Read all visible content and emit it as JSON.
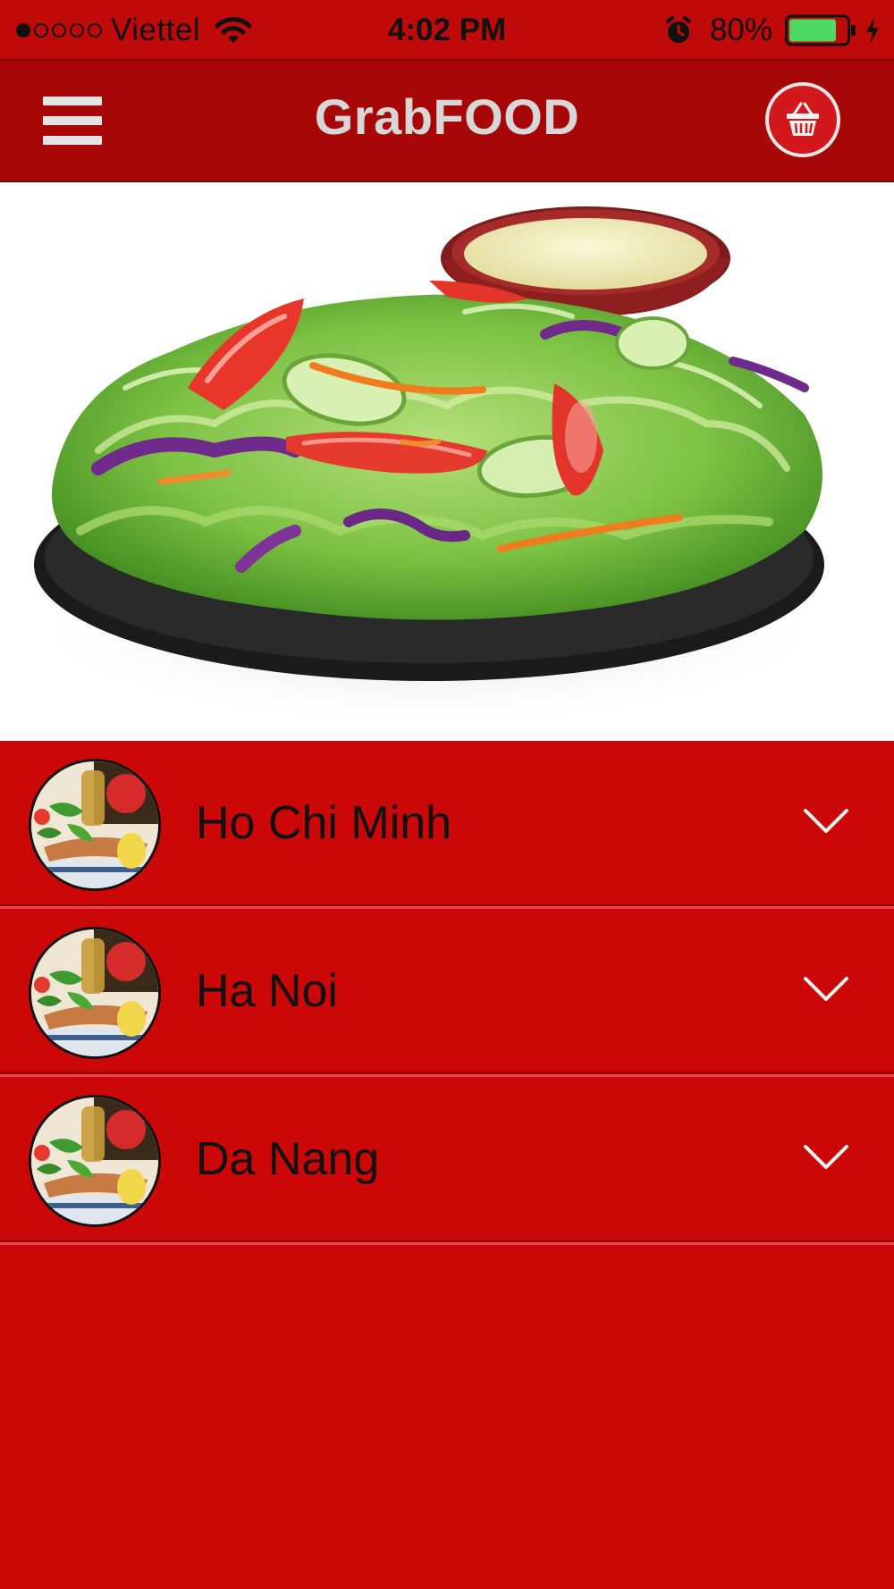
{
  "status_bar": {
    "signal_filled": 1,
    "signal_total": 5,
    "carrier": "Viettel",
    "wifi_icon": "wifi-icon",
    "time": "4:02 PM",
    "alarm_icon": "alarm-clock-icon",
    "battery_percent": "80%",
    "battery_level": 0.8,
    "battery_color": "#4cd964",
    "charging_icon": "lightning-bolt-icon"
  },
  "header": {
    "menu_icon": "hamburger-menu-icon",
    "title": "GrabFOOD",
    "cart_icon": "shopping-basket-icon",
    "background": "#a80707"
  },
  "hero": {
    "image": "salad-plate-with-dressing"
  },
  "cities": [
    {
      "name": "Ho Chi Minh",
      "icon": "food-dish-thumbnail",
      "chevron": "chevron-down-icon"
    },
    {
      "name": "Ha Noi",
      "icon": "food-dish-thumbnail",
      "chevron": "chevron-down-icon"
    },
    {
      "name": "Da Nang",
      "icon": "food-dish-thumbnail",
      "chevron": "chevron-down-icon"
    }
  ],
  "colors": {
    "primary_red": "#cc0707",
    "dark_red": "#a80707",
    "title_gray": "#d7d7d7"
  }
}
